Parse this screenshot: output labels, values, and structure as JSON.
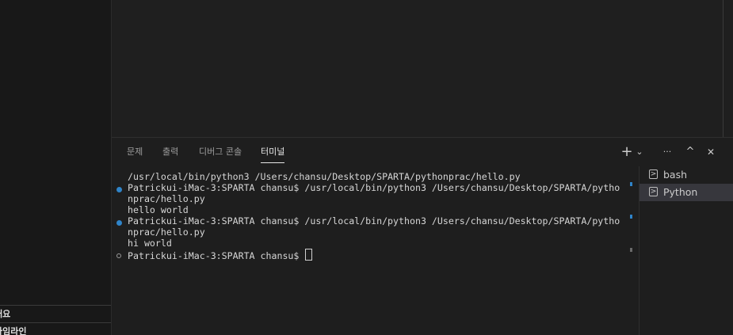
{
  "sidebar": {
    "sections": [
      {
        "label": "개요"
      },
      {
        "label": "타임라인"
      }
    ]
  },
  "panel": {
    "tabs": [
      {
        "label": "문제"
      },
      {
        "label": "출력"
      },
      {
        "label": "디버그 콘솔"
      },
      {
        "label": "터미널",
        "active": true
      }
    ],
    "actions": {
      "new_terminal": "+",
      "dropdown": "⌄",
      "more": "···",
      "maximize": "^",
      "close": "✕"
    }
  },
  "terminal": {
    "lines": [
      "/usr/local/bin/python3 /Users/chansu/Desktop/SPARTA/pythonprac/hello.py",
      "Patrickui-iMac-3:SPARTA chansu$ /usr/local/bin/python3 /Users/chansu/Desktop/SPARTA/pytho",
      "nprac/hello.py",
      "hello world",
      "Patrickui-iMac-3:SPARTA chansu$ /usr/local/bin/python3 /Users/chansu/Desktop/SPARTA/pytho",
      "nprac/hello.py",
      "hi world",
      "Patrickui-iMac-3:SPARTA chansu$ "
    ],
    "colors": {
      "success_dot": "#2f84c9",
      "pending_dot": "#9a9a9a"
    }
  },
  "terminal_list": {
    "items": [
      {
        "label": "bash",
        "icon": "terminal-icon",
        "selected": false
      },
      {
        "label": "Python",
        "icon": "terminal-icon",
        "selected": true
      }
    ]
  }
}
